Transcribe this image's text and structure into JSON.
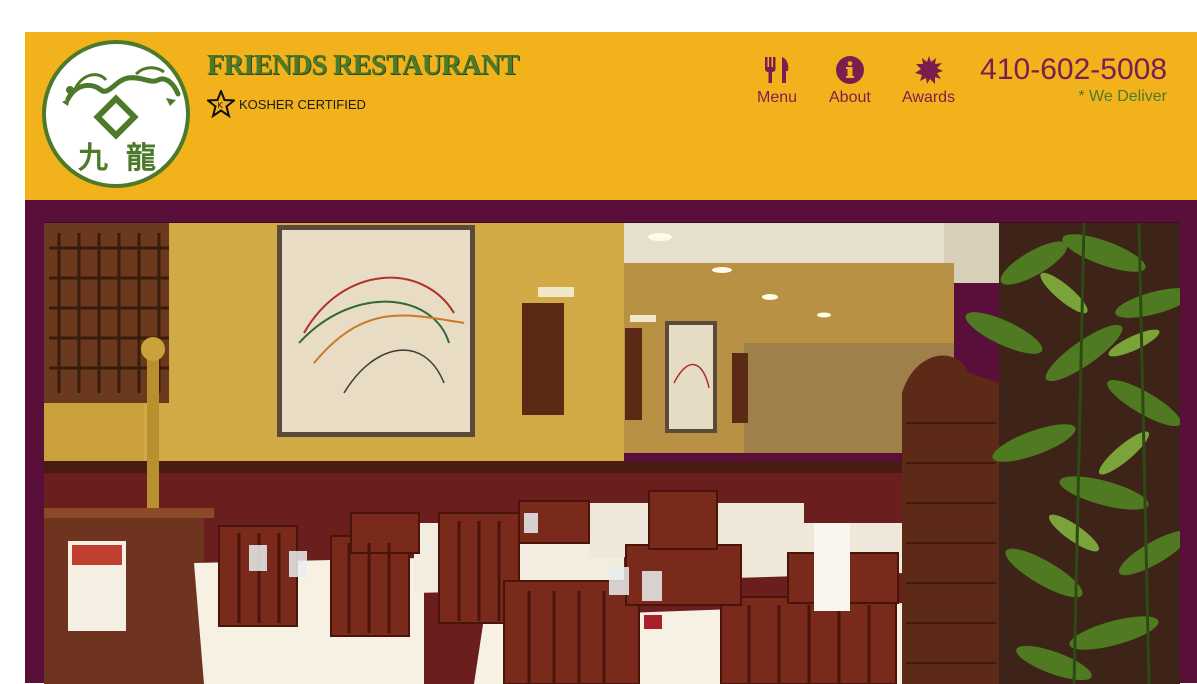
{
  "header": {
    "brand_name": "FRIENDS RESTAURANT",
    "kosher_label": "KOSHER CERTIFIED",
    "logo_characters": "九 龍"
  },
  "nav": [
    {
      "label": "Menu",
      "icon": "utensils-icon"
    },
    {
      "label": "About",
      "icon": "info-icon"
    },
    {
      "label": "Awards",
      "icon": "award-seal-icon"
    }
  ],
  "contact": {
    "phone": "410-602-5008",
    "delivery_note": "* We Deliver"
  },
  "colors": {
    "header_bg": "#f2b21c",
    "accent_purple": "#7a1e4e",
    "brand_green": "#4d7a2a",
    "band_bg": "#5a0f3a"
  },
  "hero": {
    "image_subject": "restaurant dining room interior"
  }
}
